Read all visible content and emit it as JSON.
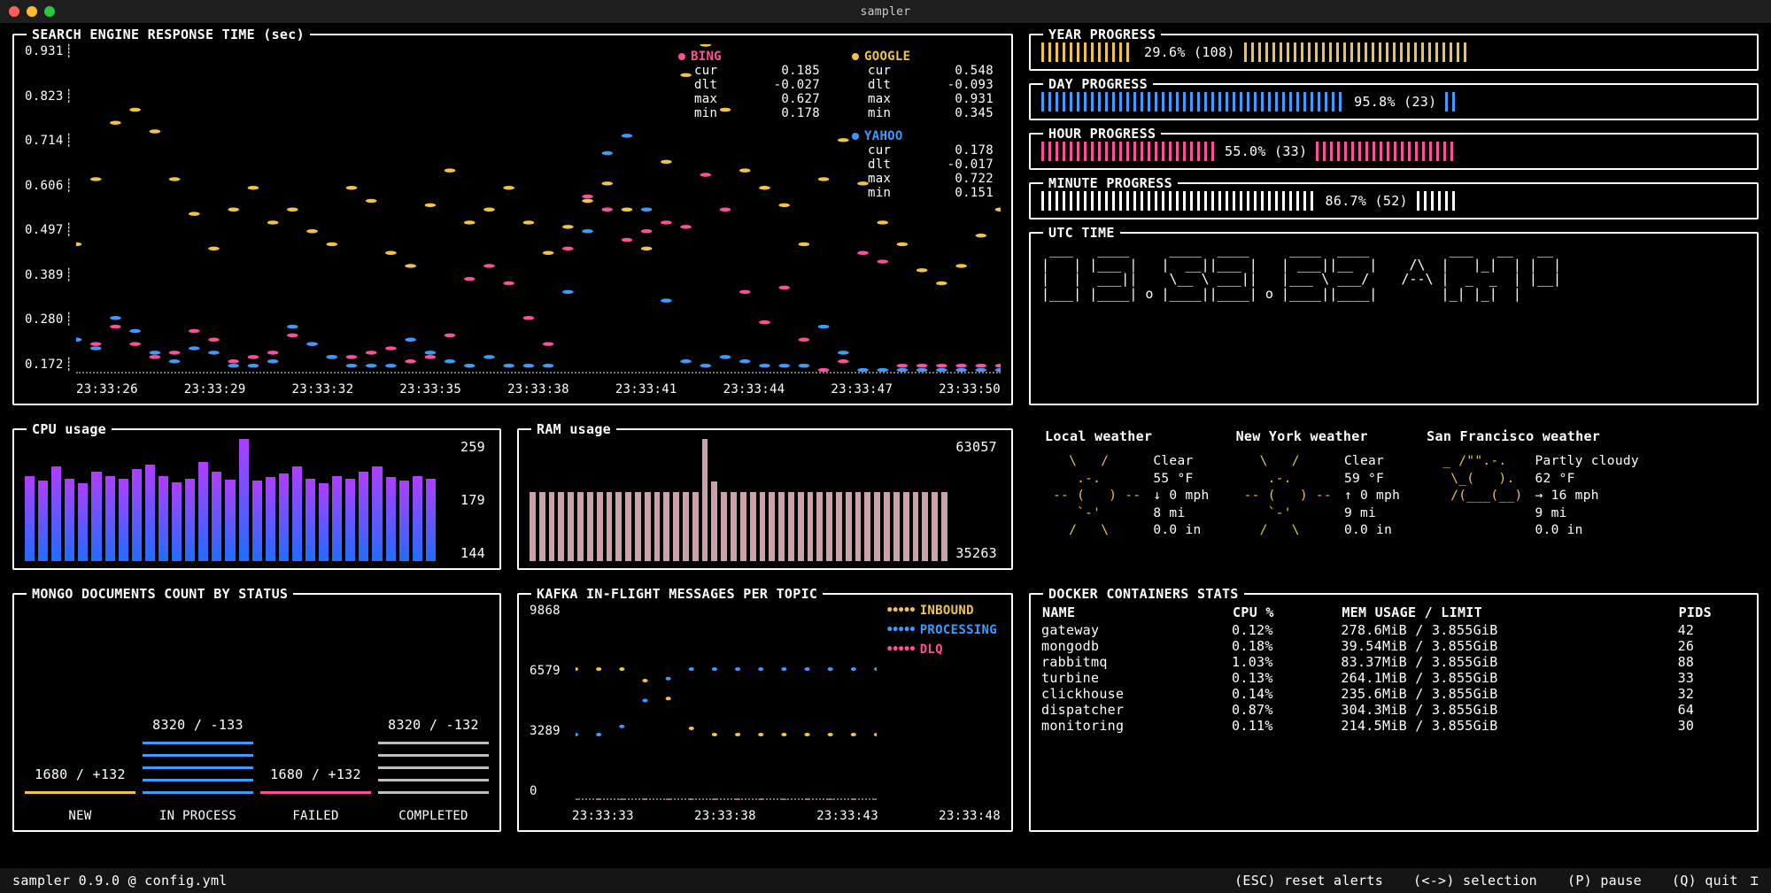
{
  "window": {
    "title": "sampler"
  },
  "colors": {
    "bing": "#ff4f9a",
    "google": "#f2c443",
    "yahoo": "#3b9bff",
    "white": "#ffffff",
    "grey": "#bfbfbf",
    "cpu_top": "#b03dff",
    "cpu_bot": "#1f6dff",
    "ram": "#caa2a8"
  },
  "search_chart": {
    "title": "SEARCH ENGINE RESPONSE TIME (sec)",
    "y_ticks": [
      "0.931",
      "0.823",
      "0.714",
      "0.606",
      "0.497",
      "0.389",
      "0.280",
      "0.172"
    ],
    "x_ticks": [
      "23:33:26",
      "23:33:29",
      "23:33:32",
      "23:33:35",
      "23:33:38",
      "23:33:41",
      "23:33:44",
      "23:33:47",
      "23:33:50"
    ],
    "series": [
      {
        "name": "BING",
        "color": "bing",
        "stats": {
          "cur": "0.185",
          "dlt": "-0.027",
          "max": "0.627",
          "min": "0.178"
        },
        "y": [
          0.25,
          0.24,
          0.28,
          0.24,
          0.21,
          0.22,
          0.27,
          0.25,
          0.2,
          0.21,
          0.22,
          0.26,
          0.24,
          0.21,
          0.21,
          0.22,
          0.23,
          0.2,
          0.21,
          0.26,
          0.39,
          0.42,
          0.38,
          0.3,
          0.24,
          0.46,
          0.58,
          0.55,
          0.48,
          0.5,
          0.52,
          0.51,
          0.63,
          0.55,
          0.36,
          0.29,
          0.37,
          0.25,
          0.18,
          0.2,
          0.45,
          0.43,
          0.19,
          0.19,
          0.19,
          0.19,
          0.19,
          0.19
        ]
      },
      {
        "name": "GOOGLE",
        "color": "google",
        "stats": {
          "cur": "0.548",
          "dlt": "-0.093",
          "max": "0.931",
          "min": "0.345"
        },
        "y": [
          0.47,
          0.62,
          0.75,
          0.78,
          0.73,
          0.62,
          0.54,
          0.46,
          0.55,
          0.6,
          0.52,
          0.55,
          0.5,
          0.47,
          0.6,
          0.57,
          0.45,
          0.42,
          0.56,
          0.64,
          0.52,
          0.55,
          0.6,
          0.52,
          0.45,
          0.51,
          0.57,
          0.61,
          0.55,
          0.46,
          0.66,
          0.86,
          0.93,
          0.78,
          0.64,
          0.6,
          0.56,
          0.47,
          0.62,
          0.71,
          0.61,
          0.52,
          0.47,
          0.41,
          0.38,
          0.42,
          0.49,
          0.55
        ]
      },
      {
        "name": "YAHOO",
        "color": "yahoo",
        "stats": {
          "cur": "0.178",
          "dlt": "-0.017",
          "max": "0.722",
          "min": "0.151"
        },
        "y": [
          0.25,
          0.23,
          0.3,
          0.27,
          0.22,
          0.2,
          0.23,
          0.22,
          0.19,
          0.19,
          0.2,
          0.28,
          0.24,
          0.21,
          0.19,
          0.19,
          0.19,
          0.25,
          0.22,
          0.2,
          0.19,
          0.21,
          0.19,
          0.19,
          0.19,
          0.36,
          0.5,
          0.68,
          0.72,
          0.55,
          0.34,
          0.2,
          0.19,
          0.21,
          0.2,
          0.19,
          0.19,
          0.19,
          0.28,
          0.22,
          0.18,
          0.18,
          0.18,
          0.18,
          0.18,
          0.18,
          0.18,
          0.18
        ]
      }
    ]
  },
  "chart_data": {
    "type": "line",
    "title": "SEARCH ENGINE RESPONSE TIME (sec)",
    "xlabel": "",
    "ylabel": "",
    "ylim": [
      0.172,
      0.931
    ],
    "x_ticks": [
      "23:33:26",
      "23:33:29",
      "23:33:32",
      "23:33:35",
      "23:33:38",
      "23:33:41",
      "23:33:44",
      "23:33:47",
      "23:33:50"
    ],
    "series": [
      {
        "name": "BING",
        "values": [
          0.25,
          0.24,
          0.28,
          0.24,
          0.21,
          0.22,
          0.27,
          0.25,
          0.2,
          0.21,
          0.22,
          0.26,
          0.24,
          0.21,
          0.21,
          0.22,
          0.23,
          0.2,
          0.21,
          0.26,
          0.39,
          0.42,
          0.38,
          0.3,
          0.24,
          0.46,
          0.58,
          0.55,
          0.48,
          0.5,
          0.52,
          0.51,
          0.63,
          0.55,
          0.36,
          0.29,
          0.37,
          0.25,
          0.18,
          0.2,
          0.45,
          0.43,
          0.19,
          0.19,
          0.19,
          0.19,
          0.19,
          0.19
        ]
      },
      {
        "name": "GOOGLE",
        "values": [
          0.47,
          0.62,
          0.75,
          0.78,
          0.73,
          0.62,
          0.54,
          0.46,
          0.55,
          0.6,
          0.52,
          0.55,
          0.5,
          0.47,
          0.6,
          0.57,
          0.45,
          0.42,
          0.56,
          0.64,
          0.52,
          0.55,
          0.6,
          0.52,
          0.45,
          0.51,
          0.57,
          0.61,
          0.55,
          0.46,
          0.66,
          0.86,
          0.93,
          0.78,
          0.64,
          0.6,
          0.56,
          0.47,
          0.62,
          0.71,
          0.61,
          0.52,
          0.47,
          0.41,
          0.38,
          0.42,
          0.49,
          0.55
        ]
      },
      {
        "name": "YAHOO",
        "values": [
          0.25,
          0.23,
          0.3,
          0.27,
          0.22,
          0.2,
          0.23,
          0.22,
          0.19,
          0.19,
          0.2,
          0.28,
          0.24,
          0.21,
          0.19,
          0.19,
          0.19,
          0.25,
          0.22,
          0.2,
          0.19,
          0.21,
          0.19,
          0.19,
          0.19,
          0.36,
          0.5,
          0.68,
          0.72,
          0.55,
          0.34,
          0.2,
          0.19,
          0.21,
          0.2,
          0.19,
          0.19,
          0.19,
          0.28,
          0.22,
          0.18,
          0.18,
          0.18,
          0.18,
          0.18,
          0.18,
          0.18,
          0.18
        ]
      }
    ]
  },
  "progress": [
    {
      "title": "YEAR PROGRESS",
      "pct": 29.6,
      "label": "29.6% (108)",
      "color": "google"
    },
    {
      "title": "DAY PROGRESS",
      "pct": 95.8,
      "label": "95.8% (23)",
      "color": "yahoo"
    },
    {
      "title": "HOUR PROGRESS",
      "pct": 55.0,
      "label": "55.0% (33)",
      "color": "bing"
    },
    {
      "title": "MINUTE PROGRESS",
      "pct": 86.7,
      "label": "86.7% (52)",
      "color": "white"
    }
  ],
  "utc": {
    "title": "UTC TIME",
    "ascii": " ___   ____     ____  ____     ____  ____          ___   __   __\n|   | |___ |   |  __||___ |   | ___||__  |    /\\  |   |_|  | |  |\n|   |  ___||    \\__ \\ ___||   |___ \\ ___/    /--\\ |  _  _  | |__|\n|___| |____| o |____||____| o |____||____|        |_| |_|  |    "
  },
  "cpu": {
    "title": "CPU usage",
    "max": "259",
    "mid": "179",
    "min": "144",
    "bars": [
      180,
      170,
      200,
      175,
      165,
      190,
      180,
      175,
      195,
      205,
      180,
      168,
      175,
      210,
      190,
      172,
      259,
      170,
      178,
      185,
      200,
      175,
      165,
      180,
      175,
      190,
      200,
      178,
      170,
      180,
      175
    ]
  },
  "ram": {
    "title": "RAM usage",
    "max": "63057",
    "min": "35263",
    "bars": [
      35800,
      35800,
      35800,
      35800,
      35800,
      35800,
      35800,
      35800,
      35800,
      35800,
      35800,
      35800,
      35800,
      35800,
      35800,
      35800,
      35800,
      35800,
      63057,
      41000,
      35800,
      35800,
      35800,
      35800,
      35800,
      35800,
      35800,
      35800,
      35800,
      35800,
      35800,
      35800,
      35800,
      35800,
      35800,
      35800,
      35800,
      35800,
      35800,
      35800,
      35800,
      35800,
      35800,
      35800
    ]
  },
  "mongo": {
    "title": "MONGO DOCUMENTS COUNT BY STATUS",
    "items": [
      {
        "name": "NEW",
        "value": "1680 / +132",
        "frac": 0.22,
        "color": "google"
      },
      {
        "name": "IN PROCESS",
        "value": "8320 / -133",
        "frac": 1.0,
        "color": "yahoo"
      },
      {
        "name": "FAILED",
        "value": "1680 / +132",
        "frac": 0.22,
        "color": "bing"
      },
      {
        "name": "COMPLETED",
        "value": "8320 / -132",
        "frac": 1.0,
        "color": "grey"
      }
    ]
  },
  "kafka": {
    "title": "KAFKA IN-FLIGHT MESSAGES PER TOPIC",
    "y_ticks": [
      "9868",
      "6579",
      "3289",
      "0"
    ],
    "x_ticks": [
      "23:33:33",
      "23:33:38",
      "23:33:43",
      "23:33:48"
    ],
    "series": [
      {
        "name": "INBOUND",
        "color": "google",
        "y": [
          6579,
          6579,
          6579,
          6000,
          5100,
          3600,
          3289,
          3289,
          3289,
          3289,
          3289,
          3289,
          3289,
          3289
        ]
      },
      {
        "name": "PROCESSING",
        "color": "yahoo",
        "y": [
          3289,
          3289,
          3700,
          5000,
          6100,
          6579,
          6579,
          6579,
          6579,
          6579,
          6579,
          6579,
          6579,
          6579
        ]
      },
      {
        "name": "DLQ",
        "color": "bing",
        "y": [
          0,
          0,
          0,
          0,
          0,
          0,
          0,
          0,
          0,
          0,
          0,
          0,
          0,
          0
        ]
      }
    ]
  },
  "weather": [
    {
      "title": "Local weather",
      "icon": "   \\   /\n    .-.\n -- (   ) --\n    `-'\n   /   \\",
      "text": "Clear\n55 °F\n↓ 0 mph\n8 mi\n0.0 in"
    },
    {
      "title": "New York weather",
      "icon": "   \\   /\n    .-.\n -- (   ) --\n    `-'\n   /   \\",
      "text": "Clear\n59 °F\n↑ 0 mph\n9 mi\n0.0 in"
    },
    {
      "title": "San Francisco weather",
      "icon": "  _ /\"\".-.\n   \\_(   ).\n   /(___(__)\n\n",
      "text": "Partly cloudy\n62 °F\n→ 16 mph\n9 mi\n0.0 in"
    }
  ],
  "docker": {
    "title": "DOCKER CONTAINERS STATS",
    "headers": [
      "NAME",
      "CPU %",
      "MEM USAGE / LIMIT",
      "PIDS"
    ],
    "rows": [
      [
        "gateway",
        "0.12%",
        "278.6MiB / 3.855GiB",
        "42"
      ],
      [
        "mongodb",
        "0.18%",
        "39.54MiB / 3.855GiB",
        "26"
      ],
      [
        "rabbitmq",
        "1.03%",
        "83.37MiB / 3.855GiB",
        "88"
      ],
      [
        "turbine",
        "0.13%",
        "264.1MiB / 3.855GiB",
        "33"
      ],
      [
        "clickhouse",
        "0.14%",
        "235.6MiB / 3.855GiB",
        "32"
      ],
      [
        "dispatcher",
        "0.87%",
        "304.3MiB / 3.855GiB",
        "64"
      ],
      [
        "monitoring",
        "0.11%",
        "214.5MiB / 3.855GiB",
        "30"
      ]
    ]
  },
  "footer": {
    "left": "sampler 0.9.0 @ config.yml",
    "hints": [
      "(ESC) reset alerts",
      "(<->) selection",
      "(P) pause",
      "(Q) quit"
    ]
  }
}
